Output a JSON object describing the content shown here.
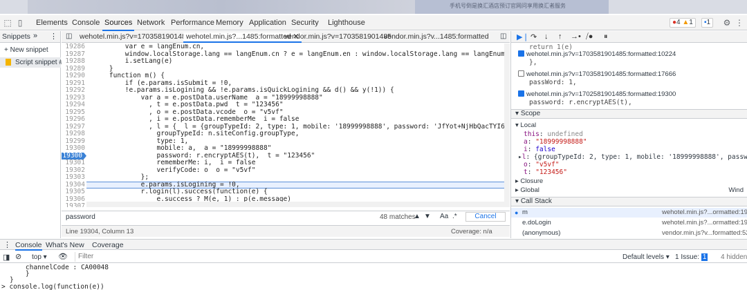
{
  "page_strip": {
    "text": "手机号倒是换汇酒店预订官网问享用换汇者服务"
  },
  "main_tabs": [
    "Elements",
    "Console",
    "Sources",
    "Network",
    "Performance",
    "Memory",
    "Application",
    "Security",
    "Lighthouse"
  ],
  "badges": {
    "errors": "4",
    "warnings": "1",
    "issues": "1"
  },
  "snippets": {
    "tab_label": "Snippets",
    "more": "»",
    "new_snippet": "+ New snippet",
    "item": "Script snippet #1"
  },
  "file_tabs": [
    "wehotel.min.js?v=1703581901485",
    "wehotel.min.js?...1485:formatted",
    "vendor.min.js?v=1703581901485",
    "vendor.min.js?v...1485:formatted"
  ],
  "code_lines": [
    {
      "n": "19286",
      "t": "        var e = langEnum.cn,"
    },
    {
      "n": "19287",
      "t": "        window.localStorage.lang == langEnum.cn ? e = langEnum.en : window.localStorage.lang == langEnum.en && (e = langEnum.jp"
    },
    {
      "n": "19288",
      "t": "        i.setLang(e)"
    },
    {
      "n": "19289",
      "t": "    }"
    },
    {
      "n": "19290",
      "t": "    function m() {"
    },
    {
      "n": "19291",
      "t": "        if (e.params.isSubmit = !0,"
    },
    {
      "n": "19292",
      "t": "        !e.params.isLogining && !e.params.isQuickLogining && d() && y(!1)) {"
    },
    {
      "n": "19293",
      "t": "            var a = e.postData.userName  a = \"18999998888\""
    },
    {
      "n": "19294",
      "t": "              , t = e.postData.pwd  t = \"123456\""
    },
    {
      "n": "19295",
      "t": "              , o = e.postData.vcode  o = \"v5vf\""
    },
    {
      "n": "19296",
      "t": "              , i = e.postData.rememberMe  i = false"
    },
    {
      "n": "19297",
      "t": "              , l = {  l = {groupTypeId: 2, type: 1, mobile: '18999998888', password: 'JfYot+NjHbQacTYI6d5KMQ==', rememberMe: f"
    },
    {
      "n": "19298",
      "t": "                groupTypeId: n.siteConfig.groupType,"
    },
    {
      "n": "19299",
      "t": "                type: 1,"
    },
    {
      "n": "19300",
      "t": "                mobile: a,  a = \"18999998888\""
    },
    {
      "n": "19300",
      "t": "                password: r.encryptAES(t),  t = \"123456\""
    },
    {
      "n": "19301",
      "t": "                rememberMe: i,  i = false"
    },
    {
      "n": "19302",
      "t": "                verifyCode: o  o = \"v5vf\""
    },
    {
      "n": "19303",
      "t": "            };"
    },
    {
      "n": "19304",
      "t": "            e.params.isLogining = !0,"
    },
    {
      "n": "19305",
      "t": "            r.login(l).success(function(e) {"
    },
    {
      "n": "19306",
      "t": "                e.success ? M(e, 1) : p(e.message)"
    },
    {
      "n": "19307",
      "t": "            }).error(function() {"
    }
  ],
  "search": {
    "value": "password",
    "matches": "48 matches",
    "case_label": "Aa",
    "regex_label": ".*",
    "cancel": "Cancel"
  },
  "status": {
    "position": "Line 19304, Column 13",
    "coverage": "Coverage: n/a"
  },
  "breakpoints": [
    {
      "file": "wehotel.min.js?v=1703581901485:formatted:10224",
      "code": "},",
      "checked": true
    },
    {
      "file": "wehotel.min.js?v=1703581901485:formatted:17666",
      "code": "passWord: 1,",
      "checked": false
    },
    {
      "file": "wehotel.min.js?v=1702581901485:formatted:19300",
      "code": "password: r.encryptAES(t),",
      "checked": true
    }
  ],
  "bp_top_partial": "return 1(e)",
  "scope": {
    "header": "Scope",
    "local": "Local",
    "this": "undefined",
    "a": "\"18999998888\"",
    "i": "false",
    "l": "{groupTypeId: 2, type: 1, mobile: '18999998888', password: 'JfYot",
    "o": "\"v5vf\"",
    "t": "\"123456\"",
    "closure": "Closure",
    "global": "Global",
    "global_val": "Wind"
  },
  "call_stack": {
    "header": "Call Stack",
    "frames": [
      {
        "fn": "m",
        "loc": "wehotel.min.js?...ormatted:19304"
      },
      {
        "fn": "e.doLogin",
        "loc": "wehotel.min.js?...ormatted:19233"
      },
      {
        "fn": "(anonymous)",
        "loc": "vendor.min.js?v...formatted:5265"
      }
    ]
  },
  "drawer_tabs": [
    "Console",
    "What's New",
    "Coverage"
  ],
  "console_toolbar": {
    "context": "top",
    "filter_placeholder": "Filter",
    "levels": "Default levels",
    "issues": "1 Issue:",
    "issue_count": "1",
    "hidden": "4 hidden"
  },
  "console_lines": [
    "    channelCode : CA00048",
    "    }",
    "}",
    "> console.log(function(e))"
  ]
}
